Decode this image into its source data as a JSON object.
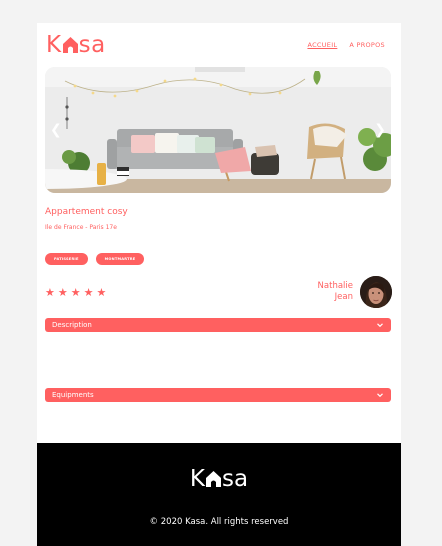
{
  "header": {
    "logo_left": "K",
    "logo_right": "sa",
    "nav": [
      {
        "label": "ACCUEIL"
      },
      {
        "label": "A PROPOS"
      }
    ]
  },
  "gallery": {
    "prev_icon": "chevron-left-icon",
    "next_icon": "chevron-right-icon"
  },
  "listing": {
    "title": "Appartement cosy",
    "location": "Ile de France - Paris 17e",
    "tags": [
      "PATISSERIE",
      "MONTMARTRE"
    ],
    "rating": 5,
    "host": {
      "first_name": "Nathalie",
      "last_name": "Jean"
    }
  },
  "collapses": [
    {
      "label": "Description",
      "icon": "chevron-down-icon"
    },
    {
      "label": "Equipments",
      "icon": "chevron-down-icon"
    }
  ],
  "footer": {
    "logo_left": "K",
    "logo_right": "sa",
    "copyright": "© 2020 Kasa. All rights reserved"
  },
  "colors": {
    "accent": "#ff6060",
    "footer_bg": "#000000",
    "page_bg": "#ffffff"
  }
}
